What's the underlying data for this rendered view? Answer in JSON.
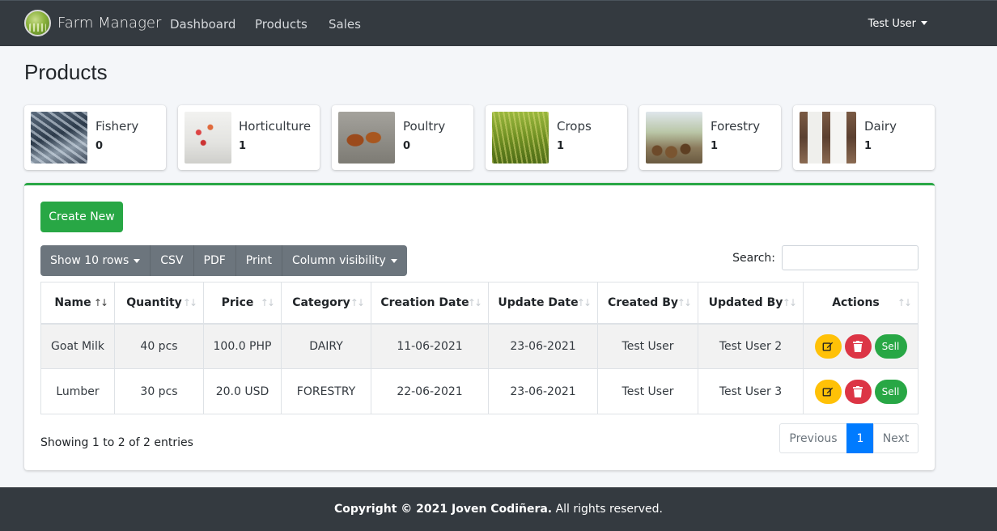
{
  "nav": {
    "brand": "Farm Manager",
    "links": [
      "Dashboard",
      "Products",
      "Sales"
    ],
    "user": "Test User"
  },
  "page_title": "Products",
  "categories": [
    {
      "name": "Fishery",
      "count": "0"
    },
    {
      "name": "Horticulture",
      "count": "1"
    },
    {
      "name": "Poultry",
      "count": "0"
    },
    {
      "name": "Crops",
      "count": "1"
    },
    {
      "name": "Forestry",
      "count": "1"
    },
    {
      "name": "Dairy",
      "count": "1"
    }
  ],
  "toolbar": {
    "create_label": "Create New",
    "buttons": [
      "Show 10 rows",
      "CSV",
      "PDF",
      "Print",
      "Column visibility"
    ],
    "search_label": "Search:",
    "search_value": ""
  },
  "table": {
    "headers": [
      "Name",
      "Quantity",
      "Price",
      "Category",
      "Creation Date",
      "Update Date",
      "Created By",
      "Updated By",
      "Actions"
    ],
    "rows": [
      [
        "Goat Milk",
        "40 pcs",
        "100.0 PHP",
        "DAIRY",
        "11-06-2021",
        "23-06-2021",
        "Test User",
        "Test User 2"
      ],
      [
        "Lumber",
        "30 pcs",
        "20.0 USD",
        "FORESTRY",
        "22-06-2021",
        "23-06-2021",
        "Test User",
        "Test User 3"
      ]
    ],
    "sell_label": "Sell"
  },
  "footer_info": {
    "showing": "Showing 1 to 2 of 2 entries",
    "prev": "Previous",
    "page": "1",
    "next": "Next"
  },
  "copyright": {
    "bold": "Copyright © 2021 Joven Codiñera.",
    "rest": " All rights reserved."
  },
  "colors": {
    "accent": "#28a745",
    "navbar": "#343a40",
    "primary": "#007bff",
    "warning": "#ffc107",
    "danger": "#dc3545"
  }
}
